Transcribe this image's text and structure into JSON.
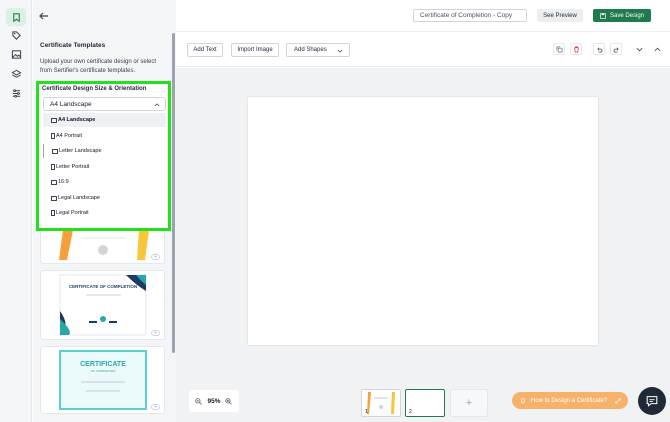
{
  "header": {
    "title_value": "Certificate of Completion - Copy",
    "see_preview_label": "See Preview",
    "save_label": "Save Design"
  },
  "sidebar": {
    "items": [
      {
        "icon": "certificate-icon",
        "active": true
      },
      {
        "icon": "tag-icon",
        "active": false
      },
      {
        "icon": "image-icon",
        "active": false
      },
      {
        "icon": "layers-icon",
        "active": false
      },
      {
        "icon": "settings-sliders-icon",
        "active": false
      }
    ]
  },
  "panel": {
    "title": "Certificate Templates",
    "description": "Upload your own certificate design or select from Sertifier's certificate templates.",
    "size_section": {
      "label": "Certificate Design Size & Orientation",
      "selected": "A4 Landscape",
      "options": [
        {
          "label": "A4 Landscape",
          "orientation": "landscape",
          "selected": true
        },
        {
          "label": "A4 Portrait",
          "orientation": "portrait"
        },
        {
          "label": "Letter Landscape",
          "orientation": "landscape"
        },
        {
          "label": "Letter Portrait",
          "orientation": "portrait"
        },
        {
          "label": "16:9",
          "orientation": "landscape"
        },
        {
          "label": "Legal Landscape",
          "orientation": "landscape"
        },
        {
          "label": "Legal Portrait",
          "orientation": "portrait"
        }
      ]
    },
    "templates": [
      {
        "title": ""
      },
      {
        "title": "CERTIFICATE OF COMPLETION"
      },
      {
        "title": "CERTIFICATE",
        "subtitle": "OF COMPLETION"
      }
    ]
  },
  "toolbar": {
    "add_text": "Add Text",
    "import_image": "Import Image",
    "add_shapes": "Add Shapes"
  },
  "bottom": {
    "zoom": "95%",
    "pages": [
      "1",
      "2"
    ],
    "add_page": "+",
    "howto_label": "How to Design a Certificate?"
  },
  "colors": {
    "brand": "#1f7a4d",
    "highlight": "#22e01b",
    "howto": "#f6b26b"
  }
}
